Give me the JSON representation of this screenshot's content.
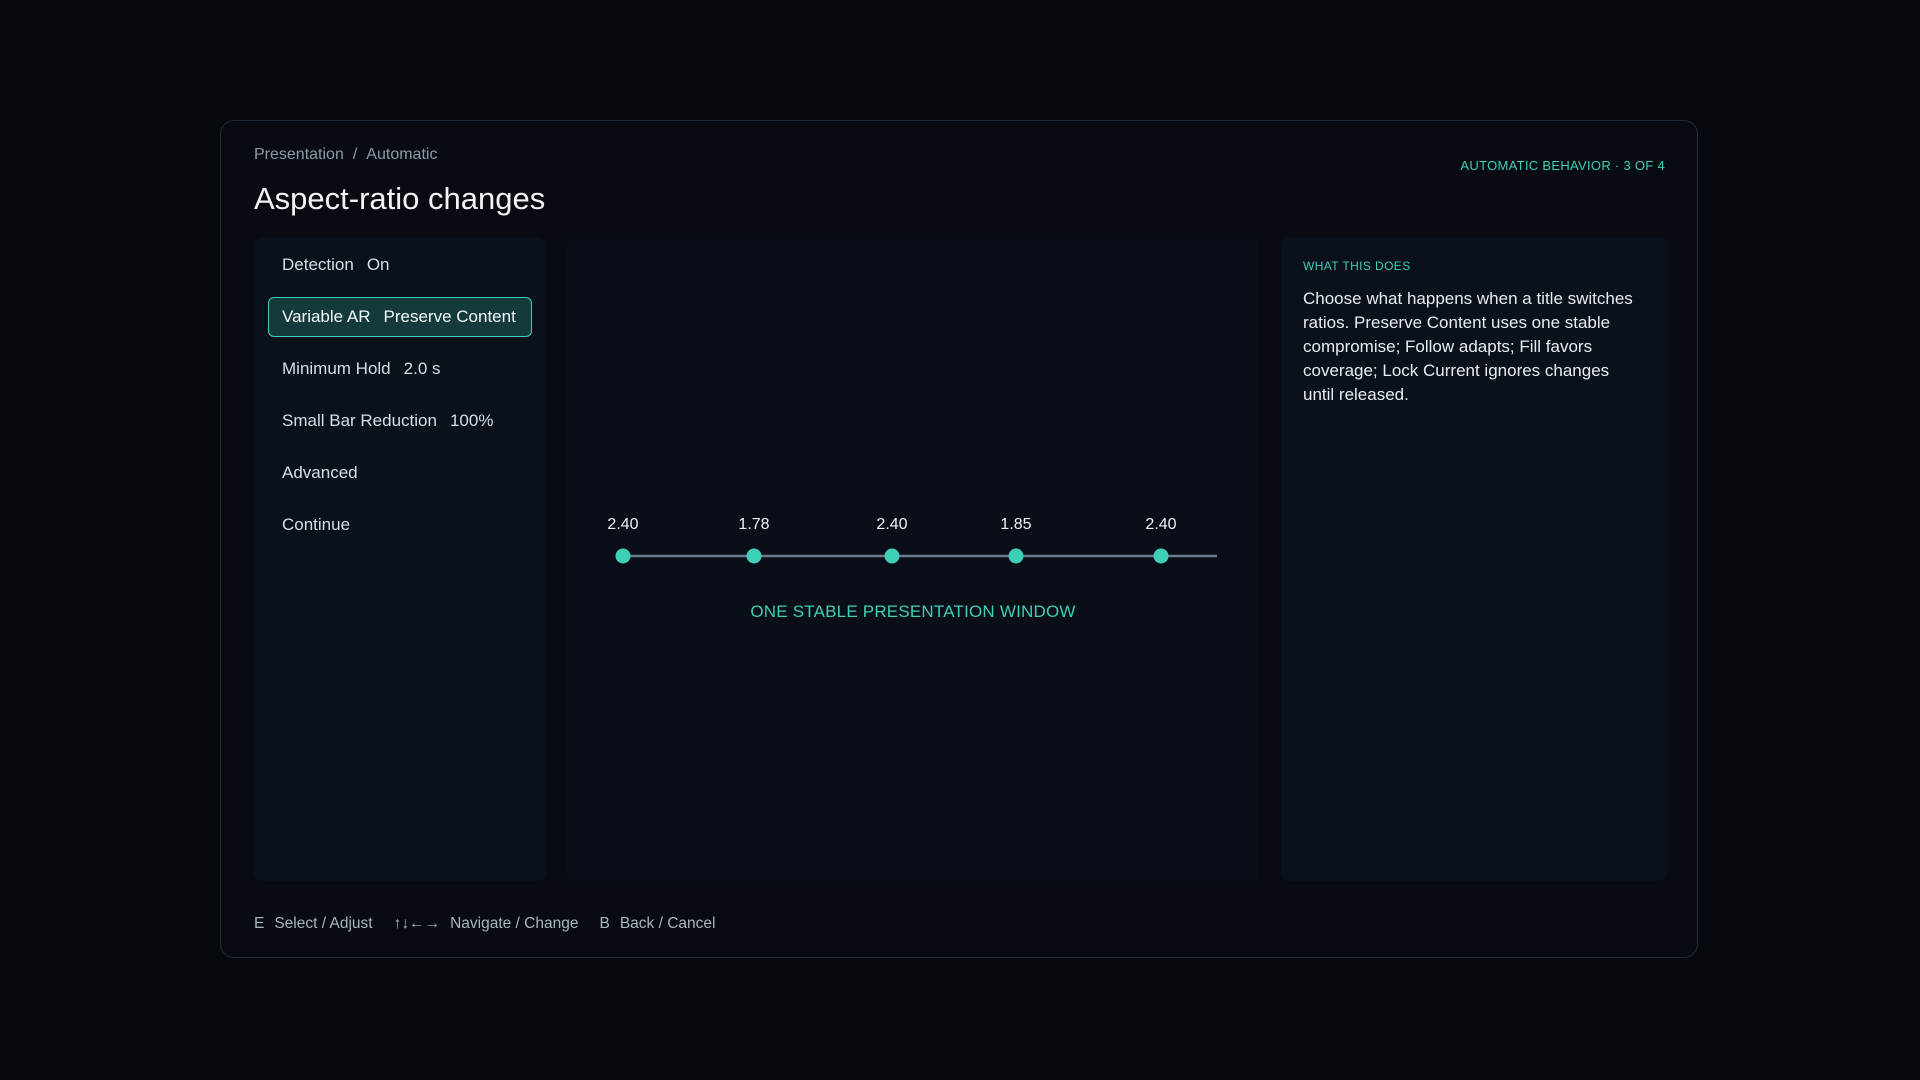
{
  "breadcrumb": {
    "parent": "Presentation",
    "separator": "/",
    "current": "Automatic"
  },
  "page_title": "Aspect-ratio changes",
  "step_indicator": "AUTOMATIC BEHAVIOR · 3 OF 4",
  "menu": {
    "detection": {
      "label": "Detection",
      "value": "On"
    },
    "variable_ar": {
      "label": "Variable AR",
      "value": "Preserve Content"
    },
    "minimum_hold": {
      "label": "Minimum Hold",
      "value": "2.0 s"
    },
    "small_bar_reduction": {
      "label": "Small Bar Reduction",
      "value": "100%"
    },
    "advanced": {
      "label": "Advanced"
    },
    "continue": {
      "label": "Continue"
    }
  },
  "timeline": {
    "points": [
      "2.40",
      "1.78",
      "2.40",
      "1.85",
      "2.40"
    ],
    "caption": "ONE STABLE PRESENTATION WINDOW"
  },
  "info": {
    "heading": "WHAT THIS DOES",
    "body": "Choose what happens when a title switches ratios. Preserve Content uses one stable compromise; Follow adapts; Fill favors coverage; Lock Current ignores changes until released."
  },
  "footer": {
    "hints": [
      {
        "key": "E",
        "label": "Select / Adjust"
      },
      {
        "key": "↑↓←→",
        "label": "Navigate / Change"
      },
      {
        "key": "B",
        "label": "Back / Cancel"
      }
    ]
  },
  "colors": {
    "accent": "#3ecfb8",
    "selected_bg": "#153a3b",
    "track": "#6b7a8c"
  }
}
